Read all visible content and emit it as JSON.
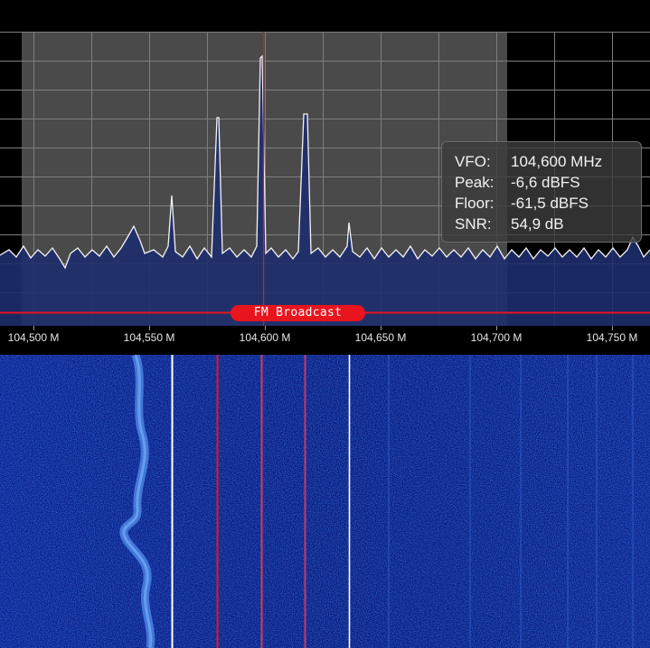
{
  "frequency_axis": {
    "labels": [
      "104,500 M",
      "104,550 M",
      "104,600 M",
      "104,650 M",
      "104,700 M",
      "104,750 M"
    ]
  },
  "info_box": {
    "rows": [
      {
        "key": "VFO:",
        "value": "104,600 MHz"
      },
      {
        "key": "Peak:",
        "value": "-6,6 dBFS"
      },
      {
        "key": "Floor:",
        "value": "-61,5 dBFS"
      },
      {
        "key": "SNR:",
        "value": "54,9 dB"
      }
    ]
  },
  "band_plan": {
    "label": "FM Broadcast"
  },
  "colors": {
    "vfo_marker": "#e8141e",
    "band_pill": "#e8141e",
    "waterfall_background": "#0a1a7a",
    "filter_passband": "#4a4a4a"
  }
}
